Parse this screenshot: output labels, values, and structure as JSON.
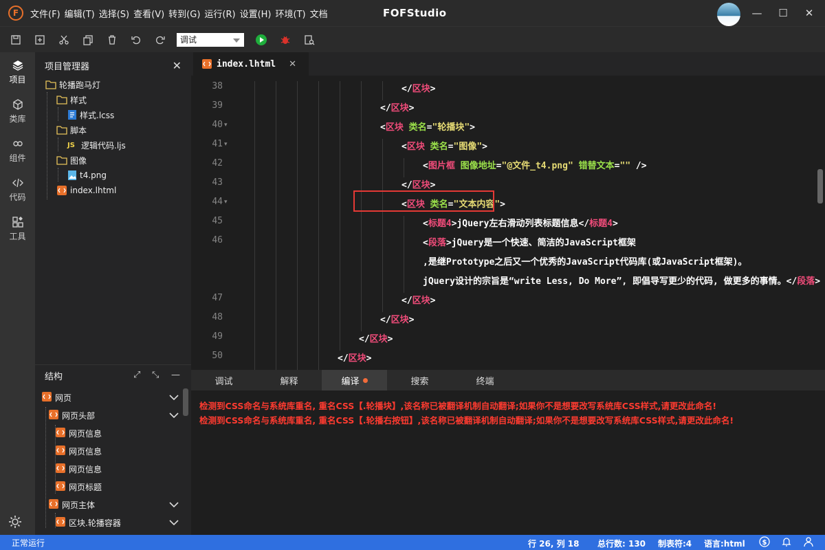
{
  "app": {
    "logo_letter": "F",
    "title": "FOFStudio",
    "menu": [
      "文件(F)",
      "编辑(T)",
      "选择(S)",
      "查看(V)",
      "转到(G)",
      "运行(R)",
      "设置(H)",
      "环境(T)",
      "文档"
    ],
    "window_controls": {
      "minimize": "—",
      "maximize": "☐",
      "close": "✕"
    }
  },
  "toolbar": {
    "mode_select_value": "调试",
    "icons": [
      "save-icon",
      "new-file-icon",
      "cut-icon",
      "copy-icon",
      "delete-icon",
      "undo-icon",
      "redo-icon",
      "run-icon",
      "debug-icon",
      "search-file-icon"
    ]
  },
  "activity_bar": {
    "items": [
      {
        "label": "项目",
        "icon": "layers-icon",
        "active": true
      },
      {
        "label": "类库",
        "icon": "cube-icon"
      },
      {
        "label": "组件",
        "icon": "link-icon"
      },
      {
        "label": "代码",
        "icon": "code-icon"
      },
      {
        "label": "工具",
        "icon": "tools-icon"
      }
    ],
    "settings_icon": "gear-icon"
  },
  "project": {
    "header": "项目管理器",
    "tree": [
      {
        "label": "轮播跑马灯",
        "type": "folder"
      },
      {
        "label": "样式",
        "type": "folder"
      },
      {
        "label": "样式.lcss",
        "type": "file-style"
      },
      {
        "label": "脚本",
        "type": "folder"
      },
      {
        "label": "逻辑代码.ljs",
        "type": "file-js",
        "badge": "JS"
      },
      {
        "label": "图像",
        "type": "folder"
      },
      {
        "label": "t4.png",
        "type": "file-image"
      },
      {
        "label": "index.lhtml",
        "type": "file-html"
      }
    ]
  },
  "structure": {
    "header": "结构",
    "items": [
      {
        "label": "网页",
        "expanded": true
      },
      {
        "label": "网页头部",
        "expanded": true
      },
      {
        "label": "网页信息"
      },
      {
        "label": "网页信息"
      },
      {
        "label": "网页信息"
      },
      {
        "label": "网页标题"
      },
      {
        "label": "网页主体",
        "expanded": true
      },
      {
        "label": "区块.轮播容器",
        "expanded": true
      }
    ]
  },
  "editor": {
    "tab": "index.lhtml",
    "lines": [
      {
        "n": "38",
        "fold": false,
        "indent": 7
      },
      {
        "n": "39",
        "fold": false,
        "indent": 6
      },
      {
        "n": "40",
        "fold": true,
        "indent": 6
      },
      {
        "n": "41",
        "fold": true,
        "indent": 7
      },
      {
        "n": "42",
        "fold": false,
        "indent": 8
      },
      {
        "n": "43",
        "fold": false,
        "indent": 7
      },
      {
        "n": "44",
        "fold": true,
        "indent": 7
      },
      {
        "n": "45",
        "fold": false,
        "indent": 8
      },
      {
        "n": "46",
        "fold": false,
        "indent": 8
      },
      {
        "n": "",
        "fold": false,
        "indent": 8
      },
      {
        "n": "",
        "fold": false,
        "indent": 8
      },
      {
        "n": "47",
        "fold": false,
        "indent": 7
      },
      {
        "n": "48",
        "fold": false,
        "indent": 6
      },
      {
        "n": "49",
        "fold": false,
        "indent": 5
      },
      {
        "n": "50",
        "fold": false,
        "indent": 4
      }
    ],
    "code": [
      [
        [
          "pt",
          "</"
        ],
        [
          "tg",
          "区块"
        ],
        [
          "pt",
          ">"
        ]
      ],
      [
        [
          "pt",
          "</"
        ],
        [
          "tg",
          "区块"
        ],
        [
          "pt",
          ">"
        ]
      ],
      [
        [
          "pt",
          "<"
        ],
        [
          "tg",
          "区块 "
        ],
        [
          "at",
          "类名"
        ],
        [
          "pt",
          "="
        ],
        [
          "st",
          "\"轮播块\""
        ],
        [
          "pt",
          ">"
        ]
      ],
      [
        [
          "pt",
          "<"
        ],
        [
          "tg",
          "区块 "
        ],
        [
          "at",
          "类名"
        ],
        [
          "pt",
          "="
        ],
        [
          "st",
          "\"图像\""
        ],
        [
          "pt",
          ">"
        ]
      ],
      [
        [
          "pt",
          "<"
        ],
        [
          "tg",
          "图片框 "
        ],
        [
          "at",
          "图像地址"
        ],
        [
          "pt",
          "="
        ],
        [
          "st",
          "\"@文件_t4.png\""
        ],
        [
          "pt",
          " "
        ],
        [
          "at",
          "错替文本"
        ],
        [
          "pt",
          "="
        ],
        [
          "st",
          "\"\""
        ],
        [
          "pt",
          " />"
        ]
      ],
      [
        [
          "pt",
          "</"
        ],
        [
          "tg",
          "区块"
        ],
        [
          "pt",
          ">"
        ]
      ],
      [
        [
          "pt",
          "<"
        ],
        [
          "tg",
          "区块 "
        ],
        [
          "at",
          "类名"
        ],
        [
          "pt",
          "="
        ],
        [
          "st",
          "\"文本内容\""
        ],
        [
          "pt",
          ">"
        ]
      ],
      [
        [
          "pt",
          "<"
        ],
        [
          "tg",
          "标题4"
        ],
        [
          "pt",
          ">jQuery左右滑动列表标题信息</"
        ],
        [
          "tg",
          "标题4"
        ],
        [
          "pt",
          ">"
        ]
      ],
      [
        [
          "pt",
          "<"
        ],
        [
          "tg",
          "段落"
        ],
        [
          "pt",
          ">jQuery是一个快速、简洁的JavaScript框架"
        ]
      ],
      [
        [
          "pt",
          ",是继Prototype之后又一个优秀的JavaScript代码库(或JavaScript框架)。"
        ]
      ],
      [
        [
          "pt",
          "jQuery设计的宗旨是“write Less, Do More”, 即倡导写更少的代码, 做更多的事情。</"
        ],
        [
          "tg",
          "段落"
        ],
        [
          "pt",
          ">"
        ]
      ],
      [
        [
          "pt",
          "</"
        ],
        [
          "tg",
          "区块"
        ],
        [
          "pt",
          ">"
        ]
      ],
      [
        [
          "pt",
          "</"
        ],
        [
          "tg",
          "区块"
        ],
        [
          "pt",
          ">"
        ]
      ],
      [
        [
          "pt",
          "</"
        ],
        [
          "tg",
          "区块"
        ],
        [
          "pt",
          ">"
        ]
      ],
      [
        [
          "pt",
          "</"
        ],
        [
          "tg",
          "区块"
        ],
        [
          "pt",
          ">"
        ]
      ]
    ]
  },
  "bottom_panel": {
    "tabs": [
      {
        "label": "调试"
      },
      {
        "label": "解释"
      },
      {
        "label": "编译",
        "active": true,
        "dot": true
      },
      {
        "label": "搜索"
      },
      {
        "label": "终端"
      }
    ],
    "messages": [
      "检测到CSS命名与系统库重名, 重名CSS【.轮播块】,该名称已被翻译机制自动翻译;如果你不是想要改写系统库CSS样式,请更改此命名!",
      "检测到CSS命名与系统库重名, 重名CSS【.轮播右按钮】,该名称已被翻译机制自动翻译;如果你不是想要改写系统库CSS样式,请更改此命名!"
    ],
    "colors": {
      "error": "#ff3b30",
      "dot": "#f26b3a"
    }
  },
  "status": {
    "left": "正常运行",
    "position": "行 26, 列 18",
    "total_lines": "总行数: 130",
    "tab_size": "制表符:4",
    "language": "语言:html",
    "icons": [
      "dollar-icon",
      "bell-icon",
      "user-icon"
    ],
    "color": "#2f6fe0"
  }
}
